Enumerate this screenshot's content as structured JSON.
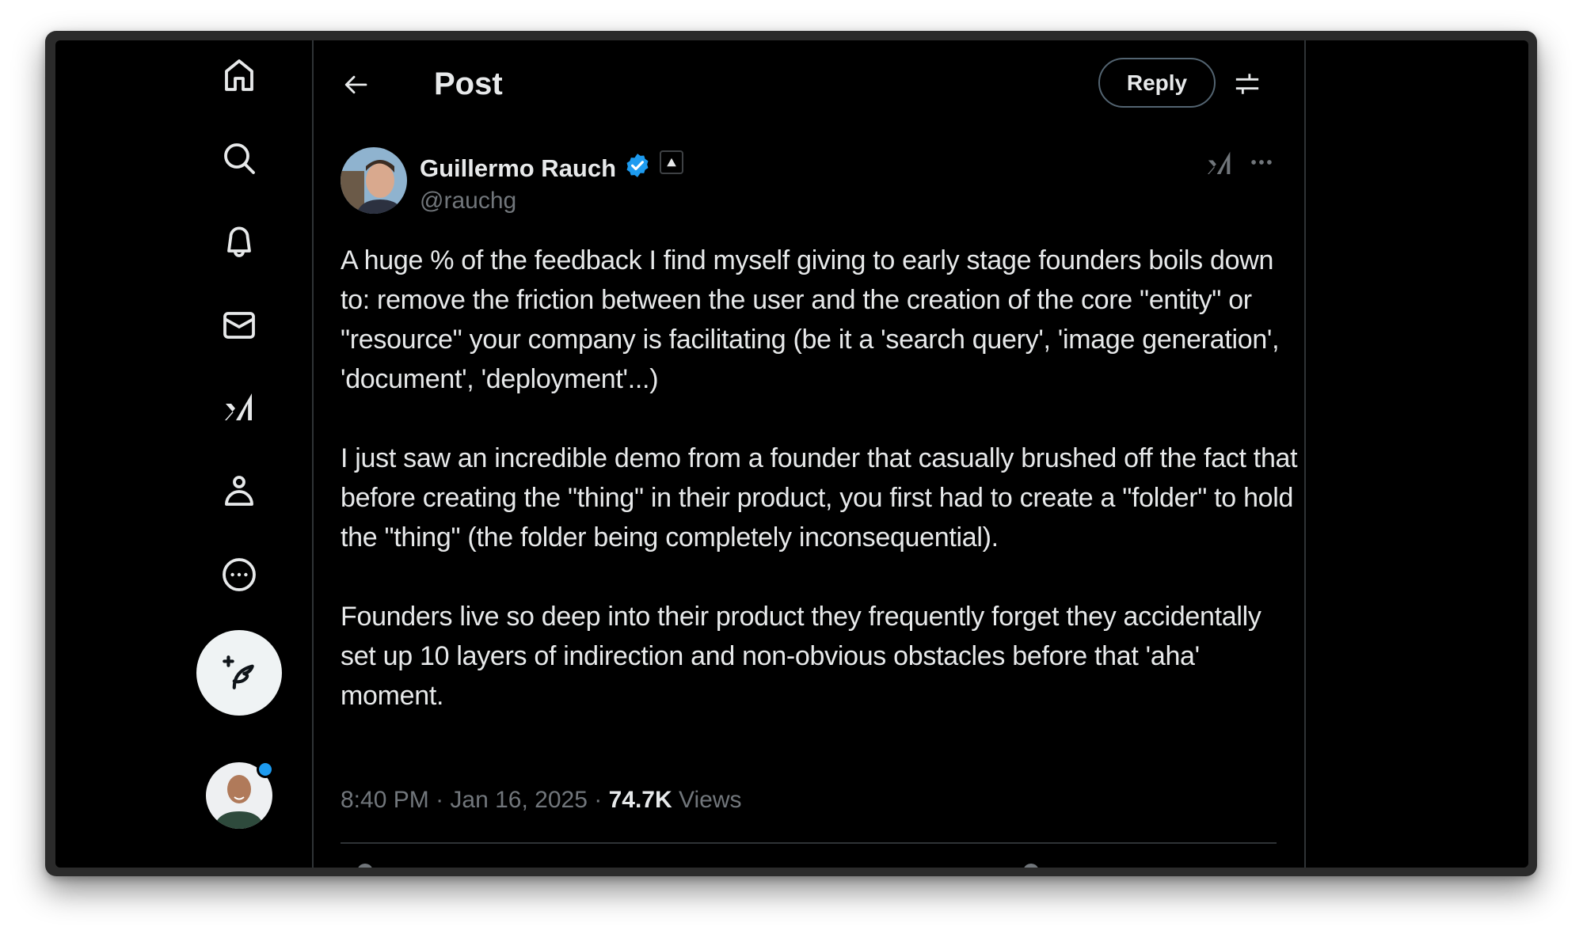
{
  "sidebar": {
    "items": [
      {
        "name": "home",
        "icon": "home-icon"
      },
      {
        "name": "explore",
        "icon": "search-icon"
      },
      {
        "name": "notifications",
        "icon": "bell-icon"
      },
      {
        "name": "messages",
        "icon": "mail-icon"
      },
      {
        "name": "grok",
        "icon": "grok-icon"
      },
      {
        "name": "profile",
        "icon": "person-icon"
      },
      {
        "name": "more",
        "icon": "more-circle-icon"
      }
    ],
    "compose_icon": "feather-plus-icon",
    "account_has_notification": true
  },
  "header": {
    "title": "Post",
    "back_icon": "arrow-left-icon",
    "reply_label": "Reply",
    "settings_icon": "sliders-icon"
  },
  "post": {
    "author_name": "Guillermo Rauch",
    "author_handle": "@rauchg",
    "verified": true,
    "affiliation_badge": "▲",
    "paragraphs": [
      "A huge % of the feedback I find myself giving to early stage founders boils down to: remove the friction between the user and the creation of the core \"entity\" or \"resource\" your company is facilitating (be it a 'search query', 'image generation', 'document', 'deployment'...)",
      "I just saw an incredible demo from a founder that casually brushed off the fact that before creating the \"thing\" in their product, you first had to create a \"folder\" to hold the \"thing\" (the folder being completely inconsequential).",
      "Founders live so deep into their product they frequently forget they accidentally set up 10 layers of indirection and non-obvious obstacles before that 'aha' moment."
    ],
    "time": "8:40 PM",
    "date": "Jan 16, 2025",
    "separator": "·",
    "views_count": "74.7K",
    "views_label": "Views"
  },
  "colors": {
    "background": "#000000",
    "text": "#e7e9ea",
    "secondary_text": "#71767b",
    "border": "#2f3336",
    "accent": "#1d9bf0"
  }
}
